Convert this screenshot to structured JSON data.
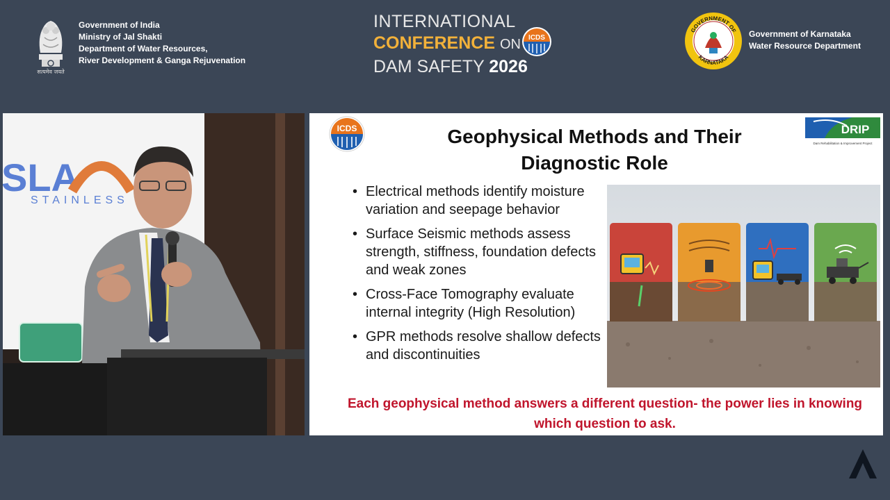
{
  "header": {
    "gov_india": {
      "lines": [
        "Government of India",
        "Ministry of Jal Shakti",
        "Department of Water Resources,",
        "River Development & Ganga Rejuvenation"
      ],
      "emblem_caption": "सत्यमेव जयते"
    },
    "conference": {
      "line1": "INTERNATIONAL",
      "line2_accent": "CONFERENCE",
      "line2_rest": "ON",
      "line3_text": "DAM SAFETY",
      "line3_year": "2026",
      "logo_text": "ICDS"
    },
    "gov_karnataka": {
      "lines": [
        "Government of Karnataka",
        "Water Resource Department"
      ],
      "seal_text_top": "GOVERNMENT OF",
      "seal_text_bottom": "KARNATAKA"
    }
  },
  "video": {
    "backdrop_logo_text": "SLA",
    "backdrop_sub_text": "STAINLESS"
  },
  "slide": {
    "title_line1": "Geophysical Methods and Their",
    "title_line2": "Diagnostic Role",
    "icds_logo_text": "ICDS",
    "drip_logo_text": "DRIP",
    "drip_sub_text": "Dam Rehabilitation & Improvement Project",
    "bullets": [
      "Electrical methods identify moisture variation and seepage behavior",
      "Surface Seismic methods assess strength, stiffness, foundation defects and weak zones",
      "Cross-Face Tomography evaluate internal integrity (High Resolution)",
      "GPR methods resolve shallow defects and discontinuities"
    ],
    "tagline": "Each geophysical method answers a different question- the power lies in knowing which question to ask."
  },
  "colors": {
    "background": "#3b4656",
    "conference_accent": "#f2b13a",
    "tagline_red": "#c0152c",
    "panel_red": "#c9443a",
    "panel_orange": "#e89a2e",
    "panel_blue": "#2f6fbf",
    "panel_green": "#6aa84f"
  }
}
